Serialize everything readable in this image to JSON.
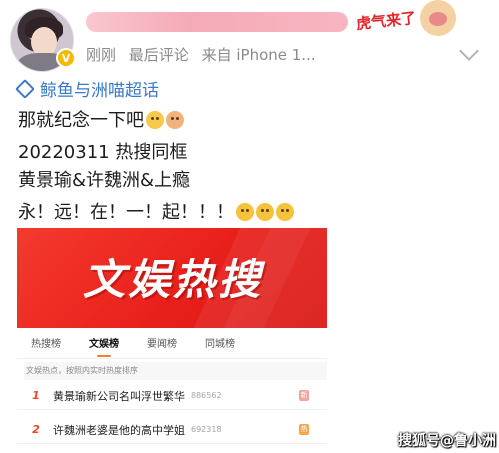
{
  "post": {
    "meta": {
      "time": "刚刚",
      "last_comment": "最后评论",
      "source": "来自 iPhone 1..."
    },
    "sticker": "虎气来了",
    "topic": "鲸鱼与洲喵超话",
    "lines": [
      "那就纪念一下吧",
      "20220311 热搜同框",
      "黄景瑜&许魏洲&上瘾",
      "永！远！在！一！起！！！"
    ]
  },
  "banner": {
    "title": "文娱热搜"
  },
  "tabs": [
    "热搜榜",
    "文娱榜",
    "要闻榜",
    "同城榜"
  ],
  "active_tab": "文娱榜",
  "hint": "文娱热点，按照内实时热度排序",
  "hot_list": [
    {
      "rank": "1",
      "title": "黄景瑜新公司名叫浮世繁华",
      "count": "886562",
      "tag": "新"
    },
    {
      "rank": "2",
      "title": "许魏洲老婆是他的高中学姐",
      "count": "692318",
      "tag": "热"
    }
  ],
  "watermark": "搜狐号@鲁小洲",
  "colors": {
    "link": "#3a79c7",
    "banner_red": "#e8201b",
    "rank_red": "#f4402c",
    "tab_underline": "#f7802d"
  }
}
